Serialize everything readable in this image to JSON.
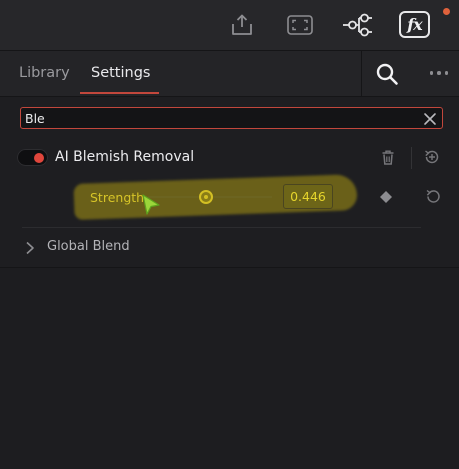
{
  "toolbar": {
    "icons": [
      "export-icon",
      "fullscreen-icon",
      "node-graph-icon",
      "fx-icon"
    ],
    "fx_label": "fx",
    "notification_color": "#e0623c"
  },
  "tabs": [
    {
      "label": "Library",
      "active": false
    },
    {
      "label": "Settings",
      "active": true
    }
  ],
  "search": {
    "value": "Ble",
    "accent": "#c2473c"
  },
  "effect": {
    "title": "AI Blemish Removal",
    "enabled": true,
    "enabled_color": "#e0463c"
  },
  "strength": {
    "label": "Strength",
    "value": "0.446",
    "highlight_color": "#a89612"
  },
  "global_blend": {
    "label": "Global Blend",
    "expanded": false
  }
}
